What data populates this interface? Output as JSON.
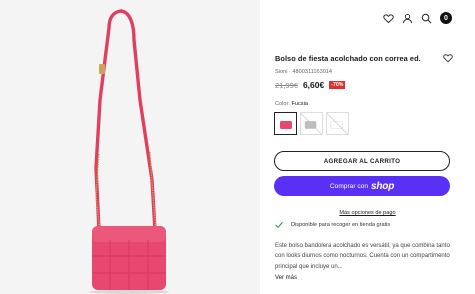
{
  "header": {
    "icons": [
      "heart-icon",
      "user-icon",
      "search-icon",
      "bag-icon"
    ],
    "cart_count": "0"
  },
  "product": {
    "title": "Bolso de fiesta acolchado con correa ed.",
    "meta": "Sioni · 4800311163014",
    "old_price": "21,99€",
    "new_price": "6,60€",
    "discount": "-70%",
    "color_label": "Color:",
    "color_value": "Fucsia",
    "swatch_colors": [
      "#e8476e",
      "#bdbdbd",
      "#ffffff"
    ]
  },
  "actions": {
    "add_to_cart": "AGREGAR AL CARRITO",
    "buy_with": "Comprar con",
    "buy_brand": "shop",
    "more_payment": "Más opciones de pago"
  },
  "availability": "Disponible para recoger en tienda gratis",
  "description": "Este bolso bandolera acolchado es versátil, ya que combina tanto con looks diurnos como nocturnos. Cuenta con un compartimento principal que incluye un...",
  "more_link": "Ver más",
  "colors": {
    "accent": "#5a31f4",
    "bag": "#e8476e",
    "discount": "#e0302d",
    "check": "#2e9e5e"
  }
}
